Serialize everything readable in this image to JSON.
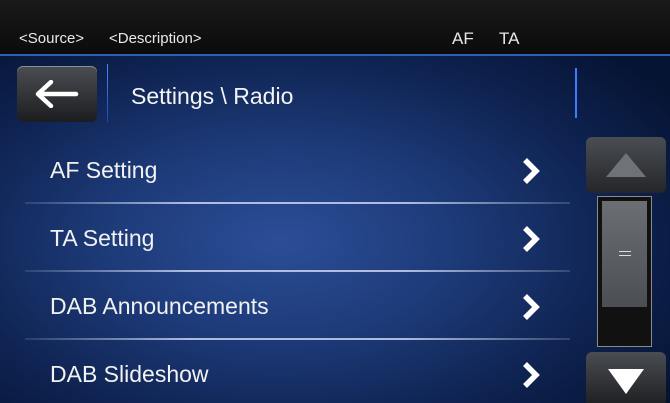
{
  "status_bar": {
    "source": "<Source>",
    "description": "<Description>",
    "af": "AF",
    "ta": "TA"
  },
  "header": {
    "back_icon": "left-arrow-icon",
    "title": "Settings \\ Radio"
  },
  "list": {
    "items": [
      {
        "label": "AF Setting",
        "icon": "chevron-right-icon"
      },
      {
        "label": "TA Setting",
        "icon": "chevron-right-icon"
      },
      {
        "label": "DAB Announcements",
        "icon": "chevron-right-icon"
      },
      {
        "label": "DAB Slideshow",
        "icon": "chevron-right-icon"
      }
    ]
  },
  "scrollbar": {
    "up_icon": "triangle-up-icon",
    "down_icon": "triangle-down-icon",
    "position": 0,
    "visible_fraction": 0.75
  },
  "colors": {
    "accent": "#3e7bff",
    "background": "#1d3a78",
    "text": "#f2f2f2"
  }
}
